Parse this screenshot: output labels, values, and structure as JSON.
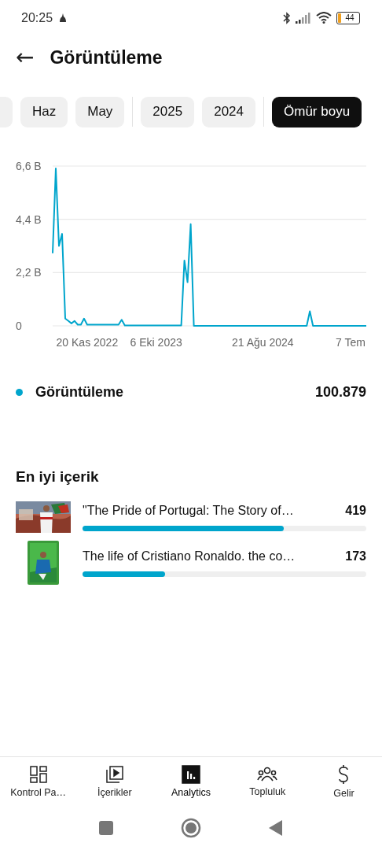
{
  "status_bar": {
    "time": "20:25",
    "battery": "44"
  },
  "header": {
    "back_icon": "←",
    "title": "Görüntüleme"
  },
  "chip_groups": [
    {
      "chips": [
        {
          "label": "Haz",
          "selected": false
        },
        {
          "label": "May",
          "selected": false
        }
      ]
    },
    {
      "chips": [
        {
          "label": "2025",
          "selected": false
        },
        {
          "label": "2024",
          "selected": false
        }
      ]
    },
    {
      "chips": [
        {
          "label": "Ömür boyu",
          "selected": true
        }
      ]
    }
  ],
  "chart": {
    "chart_data": {
      "type": "line",
      "categories": [
        null,
        null,
        null,
        null,
        null,
        null,
        null,
        null,
        null,
        null,
        null,
        "20 Kas 2022",
        null,
        null,
        null,
        null,
        null,
        null,
        null,
        null,
        null,
        null,
        null,
        null,
        null,
        null,
        null,
        null,
        null,
        null,
        null,
        null,
        null,
        "6 Eki 2023",
        null,
        null,
        null,
        null,
        null,
        null,
        null,
        null,
        null,
        null,
        null,
        null,
        null,
        null,
        null,
        null,
        null,
        null,
        null,
        null,
        null,
        null,
        null,
        null,
        null,
        null,
        null,
        null,
        null,
        null,
        null,
        null,
        null,
        "21 Ağu 2024",
        null,
        null,
        null,
        null,
        null,
        null,
        null,
        null,
        null,
        null,
        null,
        null,
        null,
        null,
        null,
        null,
        null,
        null,
        null,
        null,
        null,
        null,
        null,
        null,
        null,
        null,
        null,
        "7 Tem",
        null,
        null,
        null,
        null,
        null
      ],
      "series": [
        {
          "color": "#00a5cc",
          "values": [
            3.0,
            6.5,
            3.3,
            3.8,
            0.3,
            0.2,
            0.1,
            0.2,
            0.05,
            0.05,
            0.3,
            0.05,
            0.05,
            0.05,
            0.05,
            0.05,
            0.05,
            0.05,
            0.05,
            0.05,
            0.05,
            0.05,
            0.25,
            0.02,
            0.02,
            0.02,
            0.02,
            0.02,
            0.02,
            0.02,
            0.02,
            0.02,
            0.02,
            0.02,
            0.02,
            0.02,
            0.02,
            0.02,
            0.02,
            0.02,
            0.02,
            0.02,
            2.7,
            1.8,
            4.2,
            0,
            0,
            0,
            0,
            0,
            0,
            0,
            0,
            0,
            0,
            0,
            0,
            0,
            0,
            0,
            0,
            0,
            0,
            0,
            0,
            0,
            0,
            0,
            0,
            0,
            0,
            0,
            0,
            0,
            0,
            0,
            0,
            0,
            0,
            0,
            0,
            0,
            0.6,
            0,
            0,
            0,
            0,
            0,
            0,
            0,
            0,
            0,
            0,
            0,
            0,
            0,
            0,
            0,
            0,
            0,
            0
          ]
        }
      ],
      "ylim": [
        0,
        6.6
      ],
      "yticks": [
        {
          "value": 0,
          "label": "0"
        },
        {
          "value": 2.2,
          "label": "2,2 B"
        },
        {
          "value": 4.4,
          "label": "4,4 B"
        },
        {
          "value": 6.6,
          "label": "6,6 B"
        }
      ]
    }
  },
  "legend": {
    "color": "#00a5cc",
    "label": "Görüntüleme",
    "value": "100.879"
  },
  "top_content": {
    "title": "En iyi içerik",
    "items": [
      {
        "kind": "picture",
        "title": "\"The Pride of Portugal: The Story of…",
        "count": "419",
        "level": 0.71
      },
      {
        "kind": "picture",
        "title": "The life of Cristiano Ronaldo. the co…",
        "count": "173",
        "level": 0.29
      }
    ]
  },
  "bottom_nav": [
    {
      "label": "Kontrol Pa…",
      "selected": false
    },
    {
      "label": "İçerikler",
      "selected": false
    },
    {
      "label": "Analytics",
      "selected": true
    },
    {
      "label": "Topluluk",
      "selected": false
    },
    {
      "label": "Gelir",
      "selected": false
    }
  ]
}
